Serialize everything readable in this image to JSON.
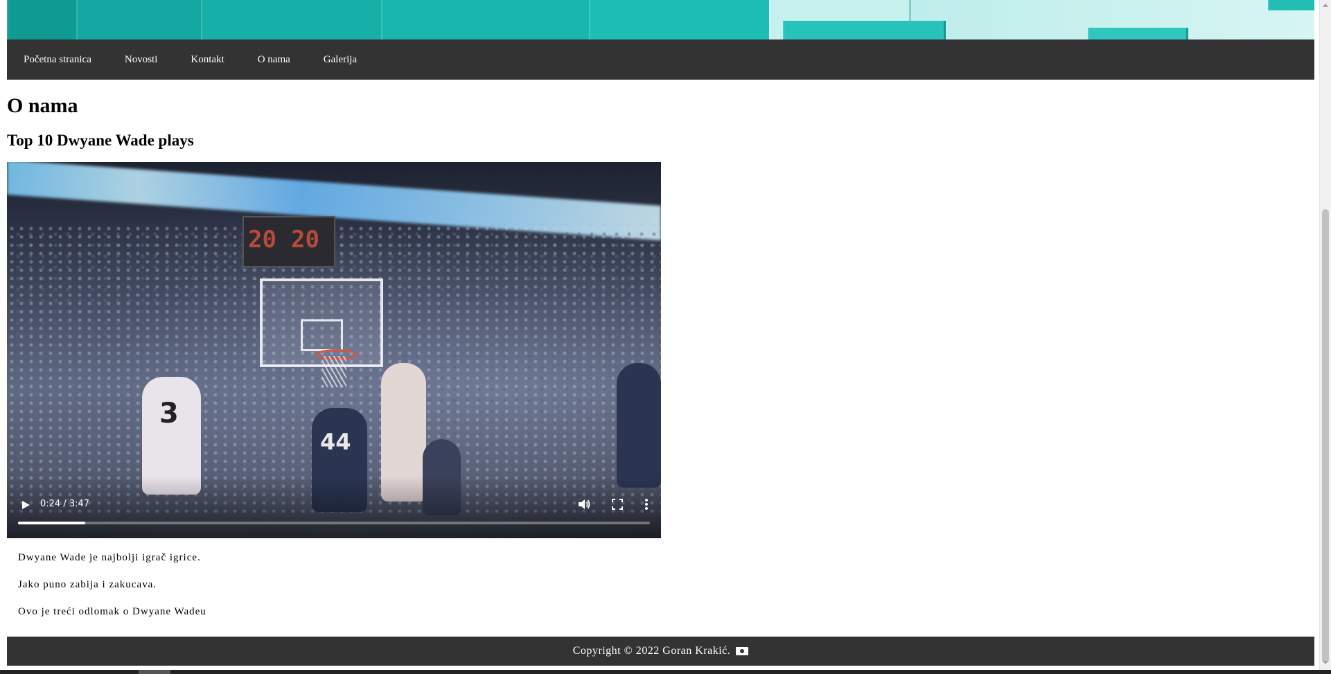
{
  "nav": {
    "items": [
      {
        "label": "Početna stranica"
      },
      {
        "label": "Novosti"
      },
      {
        "label": "Kontakt"
      },
      {
        "label": "O nama"
      },
      {
        "label": "Galerija"
      }
    ]
  },
  "main": {
    "title": "O nama",
    "video_title": "Top 10 Dwyane Wade plays",
    "video": {
      "time": "0:24 / 3:47",
      "progress": 0.106,
      "scoreboard_left": "20",
      "scoreboard_right": "20",
      "jersey_white": "3",
      "jersey_dark": "44",
      "icons": {
        "play": "play-icon",
        "volume": "volume-icon",
        "fullscreen": "fullscreen-icon",
        "more": "more-vertical-icon"
      }
    },
    "paragraphs": [
      "Dwyane Wade je najbolji igrač igrice.",
      "Jako puno zabija i zakucava.",
      "Ovo je treći odlomak o Dwyane Wadeu"
    ]
  },
  "footer": {
    "text": "Copyright © 2022 Goran Krakić.",
    "icon": "camera-icon"
  },
  "colors": {
    "nav_bg": "#333333",
    "footer_bg": "#333333",
    "nav_text": "#ffffff",
    "banner_accent": "#17b0a9"
  }
}
